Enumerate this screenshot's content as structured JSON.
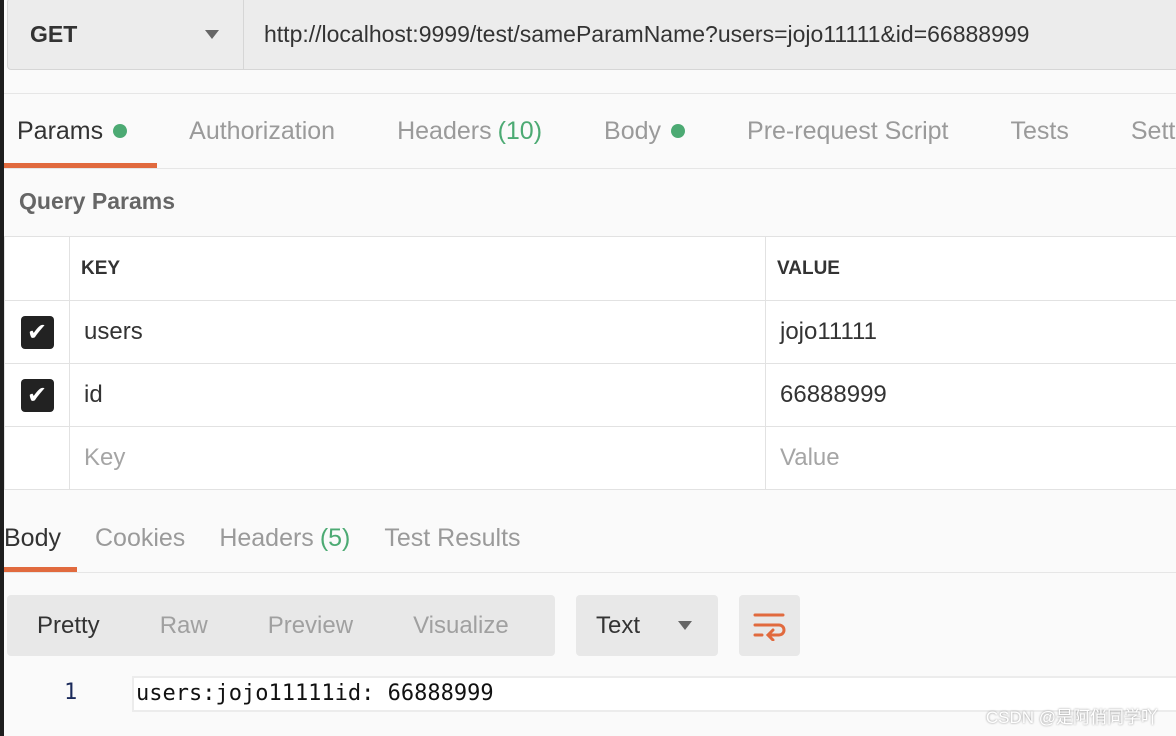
{
  "request": {
    "method": "GET",
    "url": "http://localhost:9999/test/sameParamName?users=jojo11111&id=66888999"
  },
  "request_tabs": [
    {
      "label": "Params",
      "dot": true
    },
    {
      "label": "Authorization"
    },
    {
      "label": "Headers",
      "count": "(10)"
    },
    {
      "label": "Body",
      "dot": true
    },
    {
      "label": "Pre-request Script"
    },
    {
      "label": "Tests"
    },
    {
      "label": "Settings"
    }
  ],
  "query_params": {
    "title": "Query Params",
    "headers": {
      "key": "KEY",
      "value": "VALUE"
    },
    "rows": [
      {
        "checked": true,
        "key": "users",
        "value": "jojo11111"
      },
      {
        "checked": true,
        "key": "id",
        "value": "66888999"
      }
    ],
    "placeholder": {
      "key": "Key",
      "value": "Value"
    }
  },
  "response_tabs": [
    {
      "label": "Body"
    },
    {
      "label": "Cookies"
    },
    {
      "label": "Headers",
      "count": "(5)"
    },
    {
      "label": "Test Results"
    }
  ],
  "view_modes": [
    "Pretty",
    "Raw",
    "Preview",
    "Visualize"
  ],
  "format": "Text",
  "wrap_icon": "wrap-lines-icon",
  "response_body": {
    "line": "1",
    "text": "users:jojo11111id: 66888999"
  },
  "watermark": "CSDN @是阿俏同学吖",
  "colors": {
    "accent": "#e16a3e",
    "green": "#4caa73"
  }
}
